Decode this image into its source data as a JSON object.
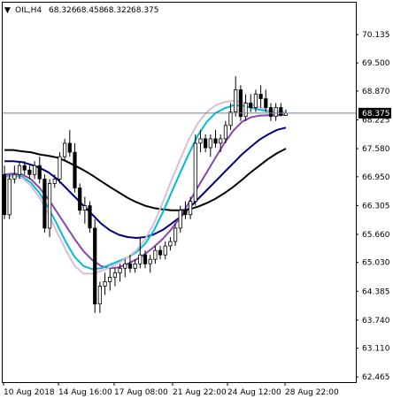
{
  "chart_data": {
    "type": "candlestick",
    "header": {
      "marker": "▼",
      "symbol": "OIL,H4",
      "open": "68.326",
      "high": "68.458",
      "low": "68.322",
      "close": "68.375"
    },
    "current_price_label": "68.375",
    "current_price": 68.375,
    "ylim": [
      62.35,
      70.85
    ],
    "y_ticks": [
      "70.135",
      "69.500",
      "68.870",
      "68.225",
      "67.580",
      "66.950",
      "66.305",
      "65.660",
      "65.030",
      "64.385",
      "63.740",
      "63.110",
      "62.465"
    ],
    "x_ticks": [
      "10 Aug 2018",
      "14 Aug 16:00",
      "17 Aug 08:00",
      "21 Aug 22:00",
      "24 Aug 12:00",
      "28 Aug 22:00"
    ],
    "grid": false,
    "colors": {
      "bull": "#000000",
      "bear": "#000000",
      "bull_fill": "#ffffff",
      "bear_fill": "#000000",
      "ma_fastest": "#d8bfd8",
      "ma_fast": "#00bcd4",
      "ma_mid": "#8e44ad",
      "ma_slow": "#000080",
      "ma_slowest": "#000000",
      "price_line": "#708090"
    },
    "candles": [
      [
        67.0,
        67.2,
        66.0,
        66.1
      ],
      [
        66.1,
        67.0,
        66.0,
        66.9
      ],
      [
        66.9,
        67.2,
        66.8,
        67.0
      ],
      [
        67.0,
        67.3,
        66.9,
        67.2
      ],
      [
        67.2,
        67.3,
        67.0,
        67.1
      ],
      [
        67.1,
        67.2,
        66.9,
        67.0
      ],
      [
        67.0,
        67.3,
        66.9,
        67.2
      ],
      [
        67.2,
        67.4,
        66.8,
        66.9
      ],
      [
        66.9,
        67.0,
        65.7,
        65.8
      ],
      [
        65.8,
        66.9,
        65.6,
        66.8
      ],
      [
        66.8,
        67.0,
        66.7,
        66.9
      ],
      [
        66.9,
        67.5,
        66.8,
        67.4
      ],
      [
        67.4,
        67.8,
        67.3,
        67.7
      ],
      [
        67.7,
        68.0,
        67.4,
        67.5
      ],
      [
        67.5,
        67.7,
        66.6,
        66.7
      ],
      [
        66.7,
        66.8,
        66.1,
        66.2
      ],
      [
        66.2,
        66.5,
        65.9,
        66.3
      ],
      [
        66.3,
        66.4,
        65.7,
        65.8
      ],
      [
        65.8,
        66.0,
        63.9,
        64.1
      ],
      [
        64.1,
        64.6,
        63.9,
        64.5
      ],
      [
        64.5,
        64.8,
        64.3,
        64.6
      ],
      [
        64.6,
        64.9,
        64.4,
        64.7
      ],
      [
        64.7,
        64.9,
        64.5,
        64.8
      ],
      [
        64.8,
        65.0,
        64.6,
        64.9
      ],
      [
        64.9,
        65.1,
        64.7,
        65.0
      ],
      [
        65.0,
        65.2,
        64.8,
        64.9
      ],
      [
        64.9,
        65.1,
        64.8,
        65.0
      ],
      [
        65.0,
        65.6,
        64.9,
        65.2
      ],
      [
        65.2,
        65.3,
        64.9,
        65.0
      ],
      [
        65.0,
        65.2,
        64.8,
        65.1
      ],
      [
        65.1,
        65.4,
        65.0,
        65.3
      ],
      [
        65.3,
        65.4,
        65.1,
        65.2
      ],
      [
        65.2,
        65.5,
        65.1,
        65.4
      ],
      [
        65.4,
        65.6,
        65.3,
        65.5
      ],
      [
        65.5,
        65.9,
        65.4,
        65.8
      ],
      [
        65.8,
        66.3,
        65.7,
        66.2
      ],
      [
        66.2,
        66.4,
        66.0,
        66.1
      ],
      [
        66.1,
        66.5,
        66.0,
        66.4
      ],
      [
        66.4,
        67.9,
        66.3,
        67.7
      ],
      [
        67.7,
        68.0,
        67.5,
        67.8
      ],
      [
        67.8,
        67.9,
        67.5,
        67.6
      ],
      [
        67.6,
        67.9,
        67.4,
        67.8
      ],
      [
        67.8,
        68.0,
        67.6,
        67.7
      ],
      [
        67.7,
        67.9,
        67.5,
        67.8
      ],
      [
        67.8,
        68.2,
        67.7,
        68.1
      ],
      [
        68.1,
        68.6,
        68.0,
        68.4
      ],
      [
        68.4,
        69.2,
        68.3,
        68.9
      ],
      [
        68.9,
        69.0,
        68.2,
        68.3
      ],
      [
        68.3,
        68.8,
        68.2,
        68.6
      ],
      [
        68.6,
        68.8,
        68.4,
        68.5
      ],
      [
        68.5,
        68.9,
        68.4,
        68.8
      ],
      [
        68.8,
        69.0,
        68.5,
        68.7
      ],
      [
        68.7,
        68.9,
        68.4,
        68.5
      ],
      [
        68.5,
        68.6,
        68.2,
        68.3
      ],
      [
        68.3,
        68.6,
        68.2,
        68.5
      ],
      [
        68.5,
        68.6,
        68.3,
        68.326
      ],
      [
        68.326,
        68.458,
        68.322,
        68.375
      ]
    ],
    "moving_averages": [
      {
        "id": "ma_slowest",
        "values": [
          67.55,
          67.55,
          67.52,
          67.5,
          67.45,
          67.42,
          67.38,
          67.3,
          67.2,
          67.1,
          66.98,
          66.85,
          66.72,
          66.6,
          66.48,
          66.38,
          66.3,
          66.25,
          66.22,
          66.2,
          66.2,
          66.22,
          66.28,
          66.36,
          66.46,
          66.58,
          66.72,
          66.88,
          67.05,
          67.2,
          67.35,
          67.48,
          67.58
        ]
      },
      {
        "id": "ma_slow",
        "values": [
          67.3,
          67.3,
          67.28,
          67.22,
          67.15,
          67.05,
          66.9,
          66.7,
          66.5,
          66.3,
          66.1,
          65.9,
          65.75,
          65.65,
          65.6,
          65.58,
          65.6,
          65.66,
          65.76,
          65.9,
          66.05,
          66.25,
          66.45,
          66.65,
          66.85,
          67.05,
          67.25,
          67.45,
          67.62,
          67.78,
          67.9,
          68.0,
          68.05
        ]
      },
      {
        "id": "ma_mid",
        "values": [
          67.0,
          67.02,
          67.0,
          66.9,
          66.7,
          66.45,
          66.15,
          65.85,
          65.55,
          65.28,
          65.08,
          64.95,
          64.9,
          64.92,
          65.0,
          65.1,
          65.22,
          65.38,
          65.56,
          65.78,
          66.05,
          66.38,
          66.72,
          67.05,
          67.38,
          67.7,
          67.98,
          68.18,
          68.28,
          68.32,
          68.33,
          68.33,
          68.34
        ]
      },
      {
        "id": "ma_fast",
        "values": [
          66.95,
          66.98,
          66.95,
          66.82,
          66.58,
          66.25,
          65.88,
          65.48,
          65.15,
          64.95,
          64.88,
          64.9,
          64.98,
          65.06,
          65.14,
          65.26,
          65.45,
          65.75,
          66.15,
          66.6,
          67.05,
          67.48,
          67.88,
          68.18,
          68.38,
          68.48,
          68.55,
          68.55,
          68.5,
          68.45,
          68.42,
          68.4,
          68.4
        ]
      },
      {
        "id": "ma_fastest",
        "values": [
          66.92,
          66.96,
          66.92,
          66.75,
          66.48,
          66.12,
          65.7,
          65.3,
          64.95,
          64.78,
          64.78,
          64.84,
          64.92,
          65.02,
          65.14,
          65.3,
          65.55,
          65.9,
          66.38,
          66.88,
          67.35,
          67.8,
          68.15,
          68.4,
          68.55,
          68.62,
          68.65,
          68.63,
          68.58,
          68.5,
          68.44,
          68.4,
          68.39
        ]
      }
    ]
  }
}
